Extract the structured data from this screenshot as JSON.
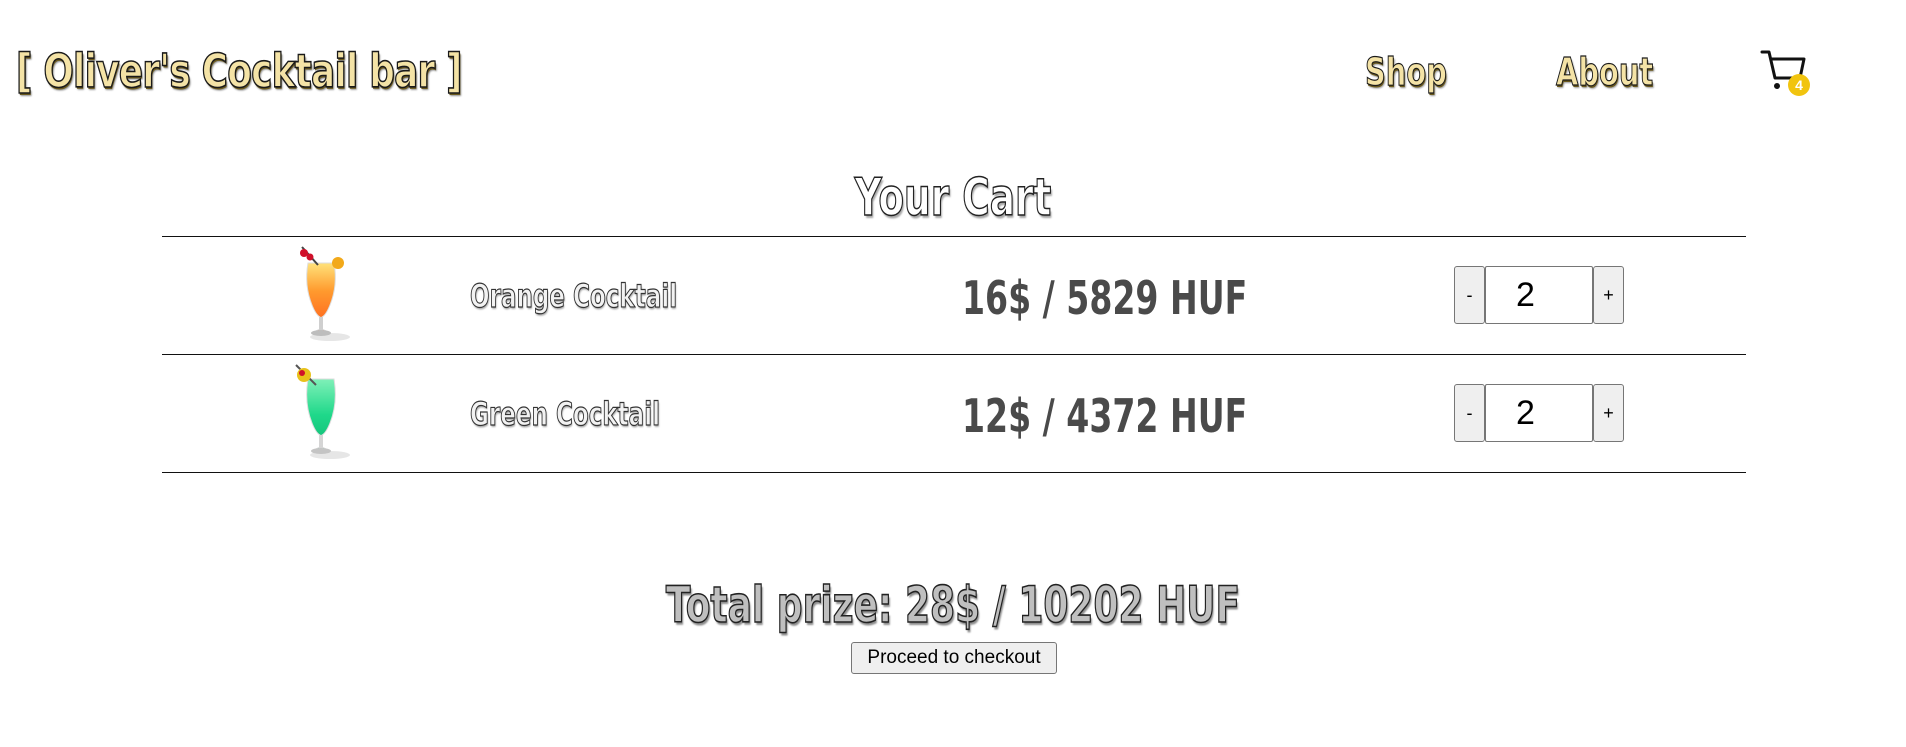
{
  "header": {
    "brand": "[ Oliver's Cocktail bar ]",
    "nav": {
      "shop": "Shop",
      "about": "About"
    },
    "cart": {
      "icon": "cart-icon",
      "count": "4",
      "badge_color": "#f1c40f"
    }
  },
  "cart": {
    "title": "Your Cart",
    "items": [
      {
        "name": "Orange Cocktail",
        "price": "16$ / 5829 HUF",
        "quantity": "2",
        "decrement_label": "-",
        "increment_label": "+",
        "image": "orange-cocktail-image"
      },
      {
        "name": "Green Cocktail",
        "price": "12$ / 4372 HUF",
        "quantity": "2",
        "decrement_label": "-",
        "increment_label": "+",
        "image": "green-cocktail-image"
      }
    ],
    "total": "Total prize: 28$ / 10202 HUF",
    "checkout_label": "Proceed to checkout"
  },
  "colors": {
    "brand_fill": "#f4e3a6",
    "price_text": "#4a4a4a",
    "total_fill": "#bfbfbf"
  }
}
